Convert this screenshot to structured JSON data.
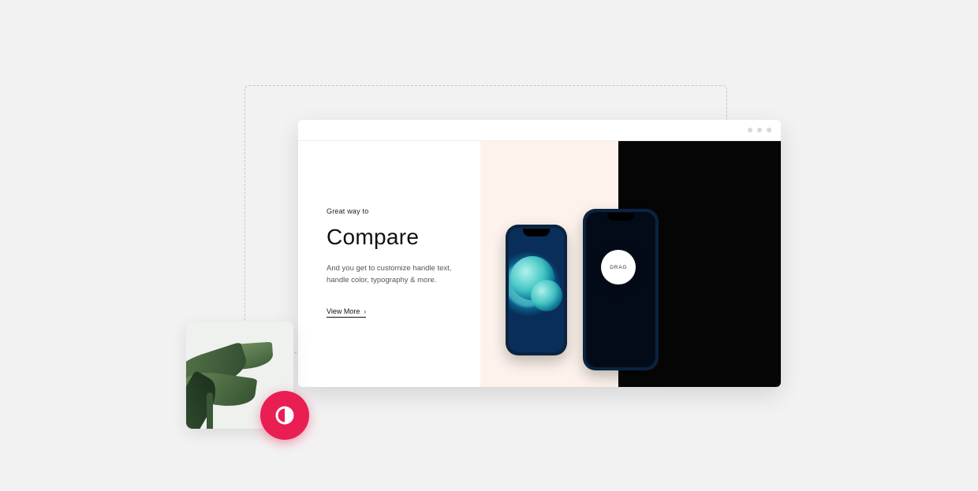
{
  "hero": {
    "eyebrow": "Great way to",
    "title": "Compare",
    "description": "And you get to customize handle text, handle color, typography & more.",
    "cta_label": "View More"
  },
  "slider": {
    "handle_label": "DRAG"
  },
  "colors": {
    "accent": "#e91e52",
    "light_pane": "#fdf3ec",
    "dark_pane": "#060606"
  }
}
